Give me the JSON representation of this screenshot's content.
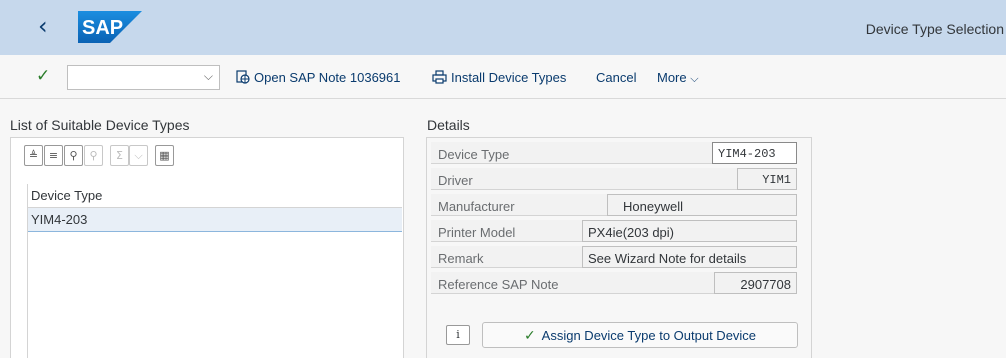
{
  "shell": {
    "logo_text": "SAP",
    "title": "Device Type Selection",
    "colors": {
      "header_bg": "#c6d8ec",
      "logo_blue": "#1272c4"
    }
  },
  "toolbar": {
    "command_value": "",
    "open_note_label": "Open SAP Note 1036961",
    "install_label": "Install Device Types",
    "cancel_label": "Cancel",
    "more_label": "More"
  },
  "list": {
    "title": "List of Suitable Device Types",
    "column_header": "Device Type",
    "rows": [
      "YIM4-203"
    ]
  },
  "details": {
    "title": "Details",
    "fields": [
      {
        "label": "Device Type",
        "value": "YIM4-203"
      },
      {
        "label": "Driver",
        "value": "YIM1"
      },
      {
        "label": "Manufacturer",
        "value": "Honeywell"
      },
      {
        "label": "Printer Model",
        "value": "PX4ie(203 dpi)"
      },
      {
        "label": "Remark",
        "value": "See Wizard Note for details"
      },
      {
        "label": "Reference SAP Note",
        "value": "2907708"
      }
    ],
    "assign_label": "Assign Device Type to Output Device"
  }
}
